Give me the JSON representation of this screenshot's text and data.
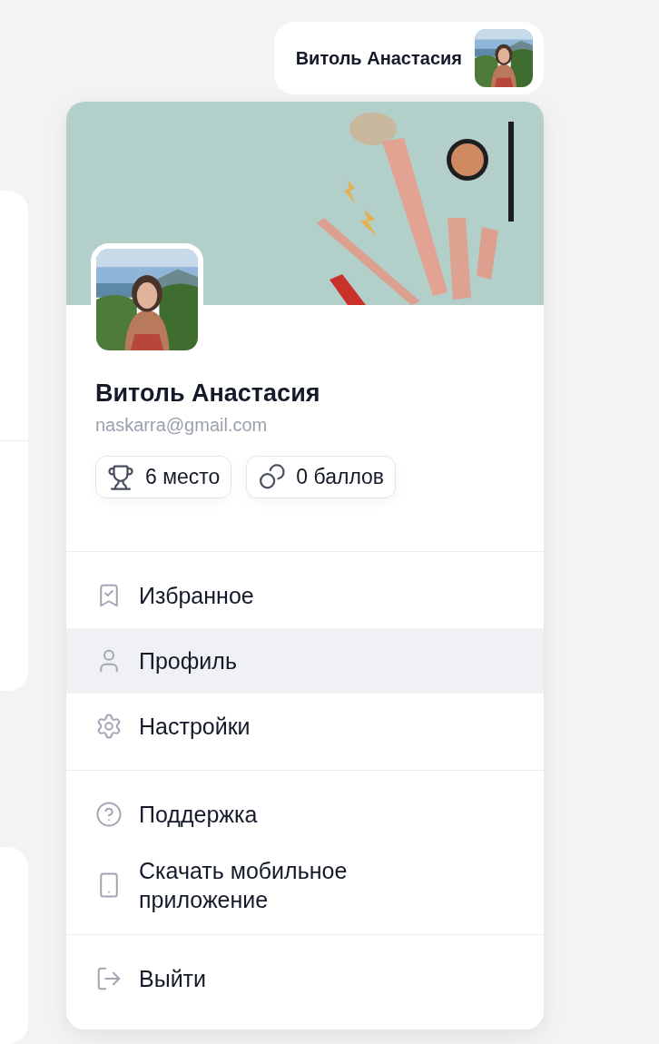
{
  "header": {
    "user_name": "Витоль Анастасия"
  },
  "profile_card": {
    "name": "Витоль Анастасия",
    "email": "naskarra@gmail.com",
    "badges": [
      "6 место",
      "0 баллов"
    ],
    "menu_sections": [
      {
        "items": [
          {
            "label": "Избранное",
            "selected": false
          },
          {
            "label": "Профиль",
            "selected": true
          },
          {
            "label": "Настройки",
            "selected": false
          }
        ]
      },
      {
        "items": [
          {
            "label": "Поддержка",
            "selected": false
          },
          {
            "label": "Скачать мобильное приложение",
            "selected": false
          }
        ]
      },
      {
        "items": [
          {
            "label": "Выйти",
            "selected": false
          }
        ]
      }
    ]
  }
}
